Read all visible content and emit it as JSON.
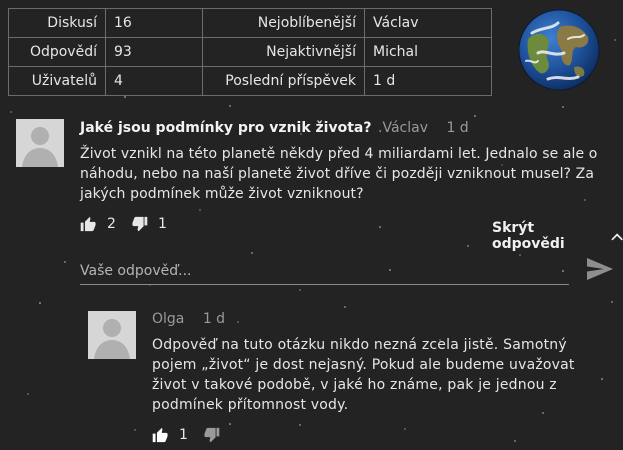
{
  "stats": {
    "rows": [
      {
        "label1": "Diskusí",
        "value1": "16",
        "label2": "Nejoblíbenější",
        "value2": "Václav"
      },
      {
        "label1": "Odpovědí",
        "value1": "93",
        "label2": "Nejaktivnější",
        "value2": "Michal"
      },
      {
        "label1": "Uživatelů",
        "value1": "4",
        "label2": "Poslední příspěvek",
        "value2": "1 d"
      }
    ]
  },
  "question": {
    "title": "Jaké jsou podmínky pro vznik života?",
    "author": "Václav",
    "time": "1 d",
    "body": "Život vznikl na této planetě někdy před 4 miliardami let. Jednalo se ale o náhodu, nebo na naší planetě život dříve či později vzniknout musel? Za jakých podmínek může život vzniknout?",
    "likes": "2",
    "dislikes": "1",
    "hide_replies": "Skrýt odpovědi"
  },
  "reply_box": {
    "placeholder": "Vaše odpověď..."
  },
  "reply": {
    "author": "Olga",
    "time": "1 d",
    "body": "Odpověď na tuto otázku nikdo nezná zcela jistě. Samotný pojem „život“ je dost nejasný. Pokud ale budeme uvažovat život v takové podobě, v jaké ho známe, pak je jednou z podmínek přítomnost vody.",
    "likes": "1"
  },
  "colors": {
    "background": "#232323",
    "text": "#e8e8e8",
    "muted": "#9a9a9a",
    "border": "#6c6c6c"
  },
  "icons": [
    "earth-globe",
    "user-avatar",
    "thumbs-up",
    "thumbs-down",
    "chevron-up",
    "send"
  ]
}
